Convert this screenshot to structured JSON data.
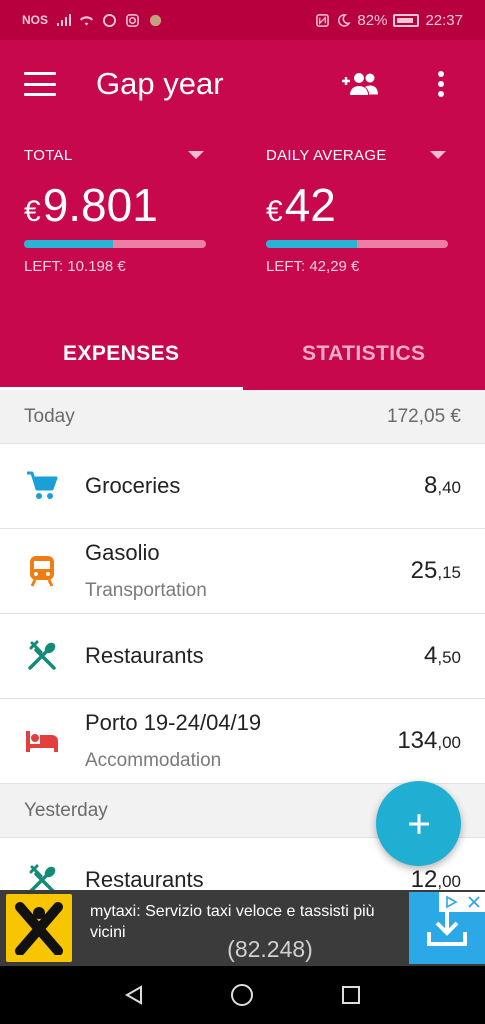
{
  "status_bar": {
    "carrier": "NOS",
    "battery": "82%",
    "time": "22:37"
  },
  "header": {
    "title": "Gap year",
    "icons": [
      "menu-icon",
      "add-person-icon",
      "more-vert-icon"
    ]
  },
  "summary": {
    "total": {
      "label": "TOTAL",
      "currency": "€",
      "value": "9.801",
      "left": "LEFT: 10.198 €",
      "progress_fraction": 0.49
    },
    "daily": {
      "label": "DAILY AVERAGE",
      "currency": "€",
      "value": "42",
      "left": "LEFT: 42,29 €",
      "progress_fraction": 0.5
    }
  },
  "tabs": [
    {
      "label": "EXPENSES",
      "active": true
    },
    {
      "label": "STATISTICS",
      "active": false
    }
  ],
  "days": [
    {
      "label": "Today",
      "total": "172,05 €",
      "items": [
        {
          "name": "Groceries",
          "sub": "",
          "int": "8",
          "dec": ",40",
          "icon": "cart-icon",
          "color": "#1a9fd6"
        },
        {
          "name": "Gasolio",
          "sub": "Transportation",
          "int": "25",
          "dec": ",15",
          "icon": "train-icon",
          "color": "#ef7d14"
        },
        {
          "name": "Restaurants",
          "sub": "",
          "int": "4",
          "dec": ",50",
          "icon": "cutlery-icon",
          "color": "#138b78"
        },
        {
          "name": "Porto 19-24/04/19",
          "sub": "Accommodation",
          "int": "134",
          "dec": ",00",
          "icon": "bed-icon",
          "color": "#e2403f"
        }
      ]
    },
    {
      "label": "Yesterday",
      "total": "",
      "items": [
        {
          "name": "Restaurants",
          "sub": "",
          "int": "12",
          "dec": ",00",
          "icon": "cutlery-icon",
          "color": "#138b78"
        }
      ]
    }
  ],
  "ad": {
    "text": "mytaxi: Servizio taxi veloce e tassisti più vicini",
    "count": "(82.248)"
  },
  "colors": {
    "primary": "#c8084c",
    "accent": "#21aed3"
  }
}
